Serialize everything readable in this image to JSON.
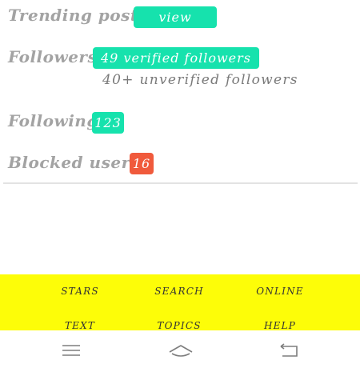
{
  "stats": {
    "trending": {
      "label": "Trending posts:",
      "button_label": "view"
    },
    "followers": {
      "label": "Followers:",
      "verified_label": "49 verified followers",
      "unverified_label": "40+ unverified followers"
    },
    "following": {
      "label": "Following:",
      "count": "123"
    },
    "blocked": {
      "label": "Blocked users:",
      "count": "16"
    }
  },
  "footer_nav": {
    "row1": [
      "STARS",
      "SEARCH",
      "ONLINE"
    ],
    "row2": [
      "TEXT",
      "TOPICS",
      "HELP"
    ]
  },
  "system_nav": {
    "icons": [
      "menu-icon",
      "home-icon",
      "back-icon"
    ]
  },
  "colors": {
    "accent_green": "#16e2ad",
    "alert_red": "#f05a3c",
    "footer_yellow": "#fdfd08",
    "label_gray": "#a3a3a3"
  }
}
